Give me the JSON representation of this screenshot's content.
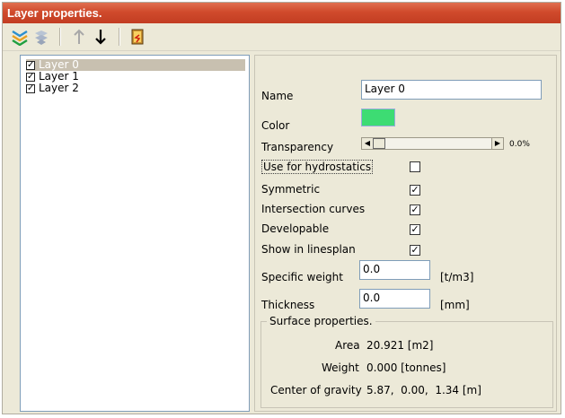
{
  "window": {
    "title": "Layer properties."
  },
  "toolbar": {
    "icons": [
      "layer-add-icon",
      "layer-delete-icon",
      "move-up-icon",
      "move-down-icon",
      "exit-icon"
    ]
  },
  "layers": [
    {
      "label": "Layer 0",
      "checked": true,
      "selected": true
    },
    {
      "label": "Layer 1",
      "checked": true,
      "selected": false
    },
    {
      "label": "Layer 2",
      "checked": true,
      "selected": false
    }
  ],
  "properties": {
    "name_label": "Name",
    "name_value": "Layer 0",
    "color_label": "Color",
    "color_value": "#3ddc73",
    "transparency_label": "Transparency",
    "transparency_value": "0.0%",
    "hydrostatics_label": "Use for hydrostatics",
    "hydrostatics_checked": "",
    "symmetric_label": "Symmetric",
    "symmetric_checked": "✓",
    "intersection_label": "Intersection curves",
    "intersection_checked": "✓",
    "developable_label": "Developable",
    "developable_checked": "✓",
    "linesplan_label": "Show in linesplan",
    "linesplan_checked": "✓",
    "specific_weight_label": "Specific weight",
    "specific_weight_value": "0.0",
    "specific_weight_unit": "[t/m3]",
    "thickness_label": "Thickness",
    "thickness_value": "0.0",
    "thickness_unit": "[mm]"
  },
  "surface": {
    "title": "Surface properties.",
    "area_label": "Area",
    "area_value": "20.921 [m2]",
    "weight_label": "Weight",
    "weight_value": "0.000 [tonnes]",
    "cog_label": "Center of gravity",
    "cog_value": "5.87,  0.00,  1.34 [m]"
  }
}
